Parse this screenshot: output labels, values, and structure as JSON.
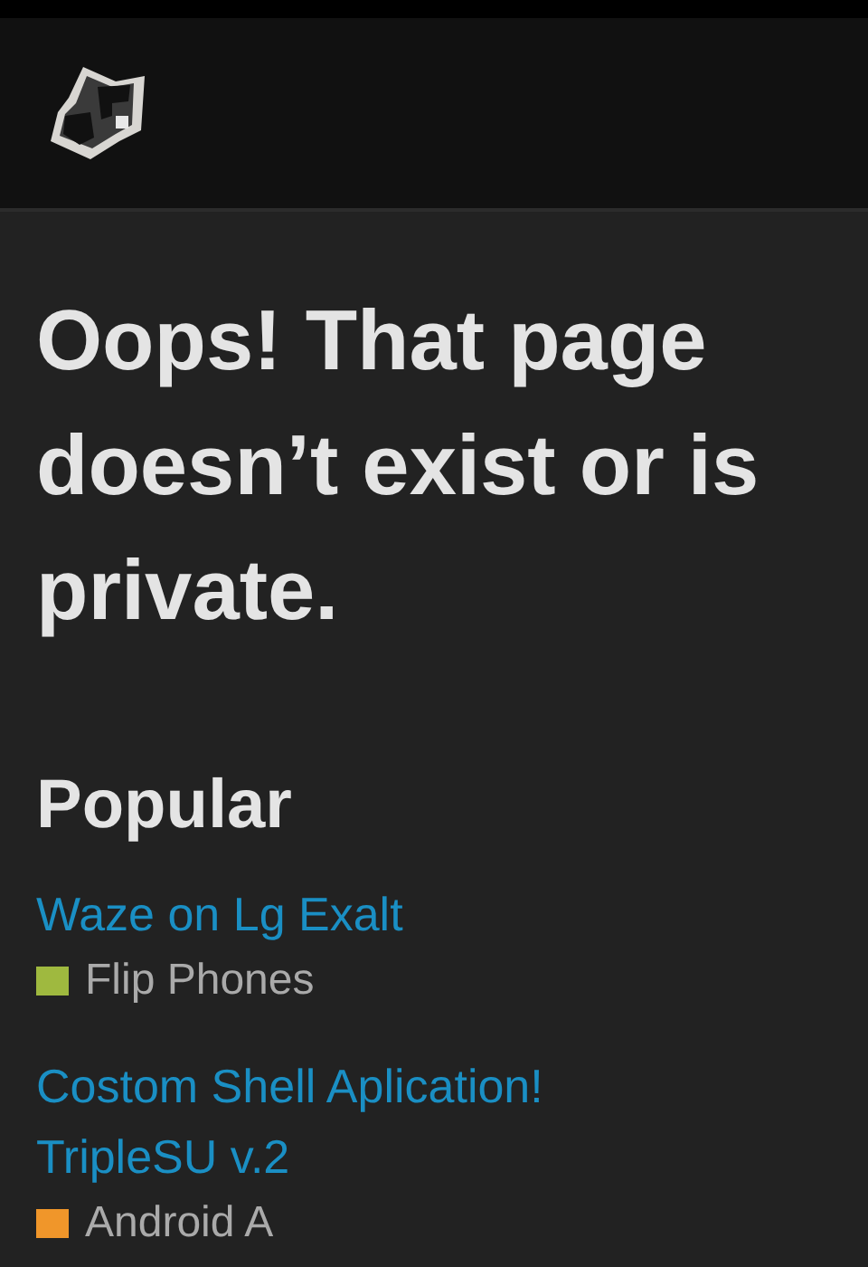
{
  "heading": "Oops! That page doesn’t exist or is private.",
  "popular": {
    "title": "Popular",
    "items": [
      {
        "title": "Waze on Lg Exalt",
        "category": "Flip Phones",
        "color": "#9fb93f"
      },
      {
        "title": "Costom Shell Aplication! TripleSU v.2",
        "category": "Android A",
        "color": "#f0962a"
      }
    ]
  }
}
